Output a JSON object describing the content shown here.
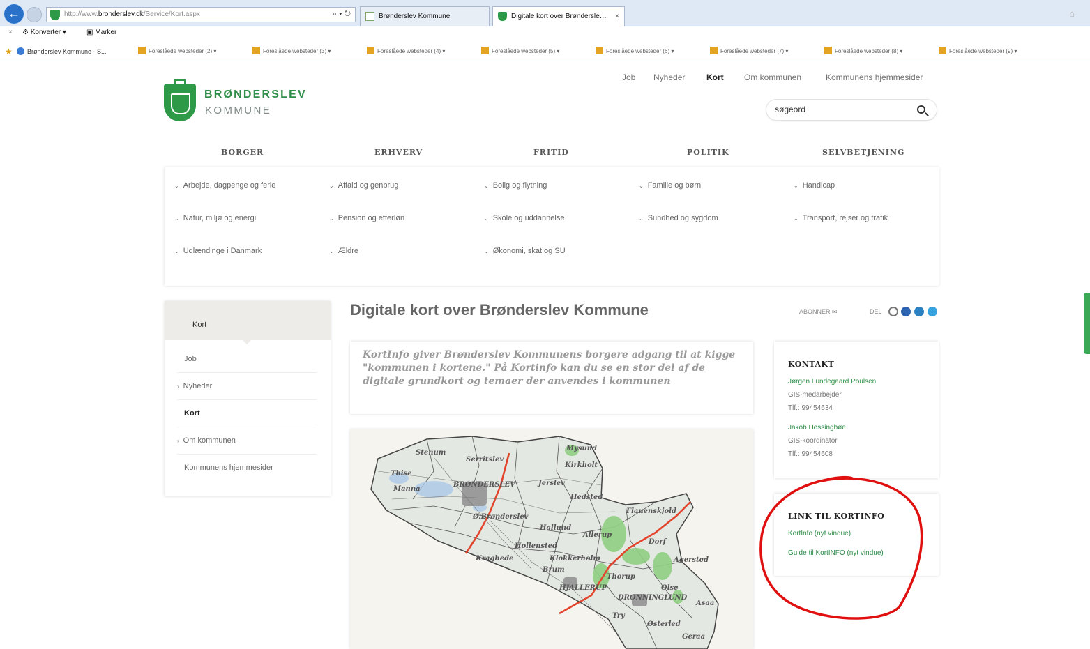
{
  "browser": {
    "url_prefix": "http://www.",
    "url_domain": "bronderslev.dk",
    "url_path": "/Service/Kort.aspx",
    "address_controls": "⌕ ▾ ↻",
    "tabs": [
      {
        "label": "Brønderslev Kommune"
      },
      {
        "label": "Digitale kort over Brønderslev Kommune"
      }
    ],
    "tab_close": "×",
    "command_bar": {
      "convert": "Konverter",
      "select": "Marker"
    },
    "favorites": {
      "first": "Brønderslev Kommune - S...",
      "folders": [
        "Foreslåede websteder (2) ▾",
        "Foreslåede websteder (3) ▾",
        "Foreslåede websteder (4) ▾",
        "Foreslåede websteder (5) ▾",
        "Foreslåede websteder (6) ▾",
        "Foreslåede websteder (7) ▾",
        "Foreslåede websteder (8) ▾",
        "Foreslåede websteder (9) ▾"
      ]
    }
  },
  "site": {
    "logo_name": "BRØNDERSLEV",
    "logo_sub": "KOMMUNE",
    "top_nav": [
      "Job",
      "Nyheder",
      "Kort",
      "Om kommunen",
      "Kommunens hjemmesider"
    ],
    "search_placeholder": "søgeord",
    "main_nav": [
      "BORGER",
      "ERHVERV",
      "FRITID",
      "POLITIK",
      "SELVBETJENING"
    ],
    "mega_menu": [
      "Arbejde, dagpenge og ferie",
      "Affald og genbrug",
      "Bolig og flytning",
      "Familie og børn",
      "Handicap",
      "Natur, miljø og energi",
      "Pension og efterløn",
      "Skole og uddannelse",
      "Sundhed og sygdom",
      "Transport, rejser og trafik",
      "Udlændinge i Danmark",
      "Ældre",
      "Økonomi, skat og SU"
    ],
    "side_nav": {
      "head": "Kort",
      "items": [
        "Job",
        "Nyheder",
        "Kort",
        "Om kommunen",
        "Kommunens hjemmesider"
      ]
    },
    "page_title": "Digitale kort over Brønderslev Kommune",
    "abonner": "ABONNER",
    "del": "DEL",
    "intro": "KortInfo giver Brønderslev Kommunens borgere adgang til at kigge \"kommunen i kortene.\" På Kortinfo kan du se en stor del af de digitale grundkort og temaer der anvendes i kommunen",
    "map_labels": [
      "Stenum",
      "Serritslev",
      "Mysund",
      "Kirkholt",
      "Thise",
      "Manna",
      "BRØNDERSLEV",
      "Jerslev",
      "Hedsted",
      "Ø.Brønderslev",
      "Hallund",
      "Flauenskjold",
      "Allerup",
      "Dorf",
      "Hollensted",
      "Agersted",
      "Kraghede",
      "Klokkerholm",
      "Brum",
      "Thorup",
      "HJALLERUP",
      "Olse",
      "DRONNINGLUND",
      "Asaa",
      "Try",
      "Østerled",
      "Geraa"
    ],
    "contact": {
      "head": "KONTAKT",
      "person1_name": "Jørgen Lundegaard Poulsen",
      "person1_title": "GIS-medarbejder",
      "person1_phone": "Tlf.: 99454634",
      "person2_name": "Jakob Hessingbøe",
      "person2_title": "GIS-koordinator",
      "person2_phone": "Tlf.: 99454608"
    },
    "links": {
      "head": "LINK TIL KORTINFO",
      "link1": "KortInfo  (nyt vindue)",
      "link2": "Guide til KortINFO (nyt vindue)"
    }
  },
  "colors": {
    "brand_green": "#2e9a48",
    "annotation_red": "#e01010",
    "map_road": "#e2442c"
  }
}
